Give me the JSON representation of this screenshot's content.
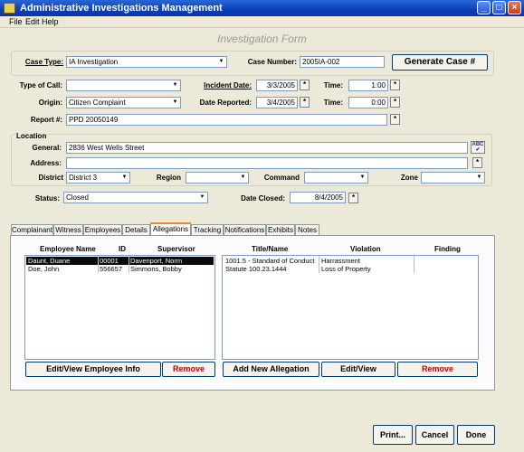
{
  "window": {
    "title": "Administrative Investigations Management"
  },
  "menu": [
    "File",
    "Edit",
    "Help"
  ],
  "form_title": "Investigation Form",
  "case": {
    "case_type_label": "Case Type:",
    "case_type": "IA Investigation",
    "case_number_label": "Case Number:",
    "case_number": "2005IA-002",
    "generate_label": "Generate Case #"
  },
  "call": {
    "type_label": "Type of Call:",
    "type_value": "",
    "incident_date_label": "Incident Date:",
    "incident_date": "3/3/2005",
    "time_label": "Time:",
    "incident_time": "1:00",
    "origin_label": "Origin:",
    "origin": "Citizen Complaint",
    "date_reported_label": "Date Reported:",
    "date_reported": "3/4/2005",
    "reported_time": "0:00",
    "report_label": "Report #:",
    "report_number": "PPD 20050149"
  },
  "location": {
    "group_label": "Location",
    "general_label": "General:",
    "general": "2836 West Wells Street",
    "address_label": "Address:",
    "address": "",
    "district_label": "District",
    "district": "District 3",
    "region_label": "Region",
    "region": "",
    "command_label": "Command",
    "command": "",
    "zone_label": "Zone",
    "zone": ""
  },
  "status": {
    "status_label": "Status:",
    "status": "Closed",
    "date_closed_label": "Date Closed:",
    "date_closed": "8/4/2005"
  },
  "tabs": [
    "Complainant",
    "Witness",
    "Employees",
    "Details",
    "Allegations",
    "Tracking",
    "Notifications",
    "Exhibits",
    "Notes"
  ],
  "active_tab": "Allegations",
  "employees": {
    "headers": {
      "name": "Employee Name",
      "id": "ID",
      "supervisor": "Supervisor"
    },
    "rows": [
      {
        "name": "Daunt, Duane",
        "id": "00001",
        "supervisor": "Davenport, Norm"
      },
      {
        "name": "Doe, John",
        "id": "556657",
        "supervisor": "Simmons, Bobby"
      }
    ],
    "edit_label": "Edit/View Employee Info",
    "remove_label": "Remove"
  },
  "allegations": {
    "headers": {
      "title": "Title/Name",
      "violation": "Violation",
      "finding": "Finding"
    },
    "rows": [
      {
        "title": "1001.5 - Standard of Conduct",
        "violation": "Harrassment",
        "finding": ""
      },
      {
        "title": "Statute 100.23.1444",
        "violation": "Loss of Property",
        "finding": ""
      }
    ],
    "add_label": "Add New Allegation",
    "edit_label": "Edit/View",
    "remove_label": "Remove"
  },
  "footer": {
    "print_label": "Print...",
    "cancel_label": "Cancel",
    "done_label": "Done"
  },
  "icons": {
    "spellcheck": "abc-check-icon",
    "calendar": "star-button-icon"
  },
  "colors": {
    "titlebar": "#0a3fb8",
    "remove": "#c00000",
    "tab_highlight": "#e68b2c"
  }
}
